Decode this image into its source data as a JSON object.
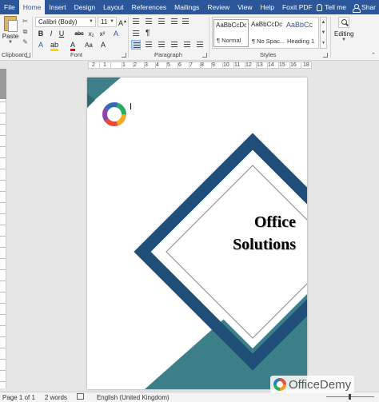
{
  "tabs": [
    "File",
    "Home",
    "Insert",
    "Design",
    "Layout",
    "References",
    "Mailings",
    "Review",
    "View",
    "Help",
    "Foxit PDF"
  ],
  "active_tab": "Home",
  "tell_me": "Tell me",
  "share": "Shar",
  "clipboard": {
    "paste_label": "Paste",
    "group_label": "Clipboard"
  },
  "font": {
    "name": "Calibri (Body)",
    "size": "11",
    "group_label": "Font",
    "buttons": [
      "B",
      "I",
      "U",
      "abc",
      "x₂",
      "x²",
      "A",
      "A",
      "A",
      "Aa",
      "A",
      "A"
    ]
  },
  "paragraph": {
    "group_label": "Paragraph"
  },
  "styles": {
    "group_label": "Styles",
    "items": [
      {
        "sample": "AaBbCcDc",
        "name": "¶ Normal"
      },
      {
        "sample": "AaBbCcDc",
        "name": "¶ No Spac..."
      },
      {
        "sample": "AaBbCc",
        "name": "Heading 1"
      }
    ]
  },
  "editing": {
    "label": "Editing"
  },
  "ruler_numbers": [
    "2",
    "1",
    "1",
    "2",
    "3",
    "4",
    "5",
    "6",
    "7",
    "8",
    "9",
    "10",
    "11",
    "12",
    "13",
    "14",
    "15",
    "16",
    "18"
  ],
  "document": {
    "title_line1": "Office",
    "title_line2": "Solutions"
  },
  "status": {
    "page": "Page 1 of 1",
    "words": "2 words",
    "language": "English (United Kingdom)"
  },
  "watermark": "OfficeDemy",
  "colors": {
    "ribbon_blue": "#2b579a",
    "navy": "#1f4e79",
    "teal": "#3c7f89"
  }
}
